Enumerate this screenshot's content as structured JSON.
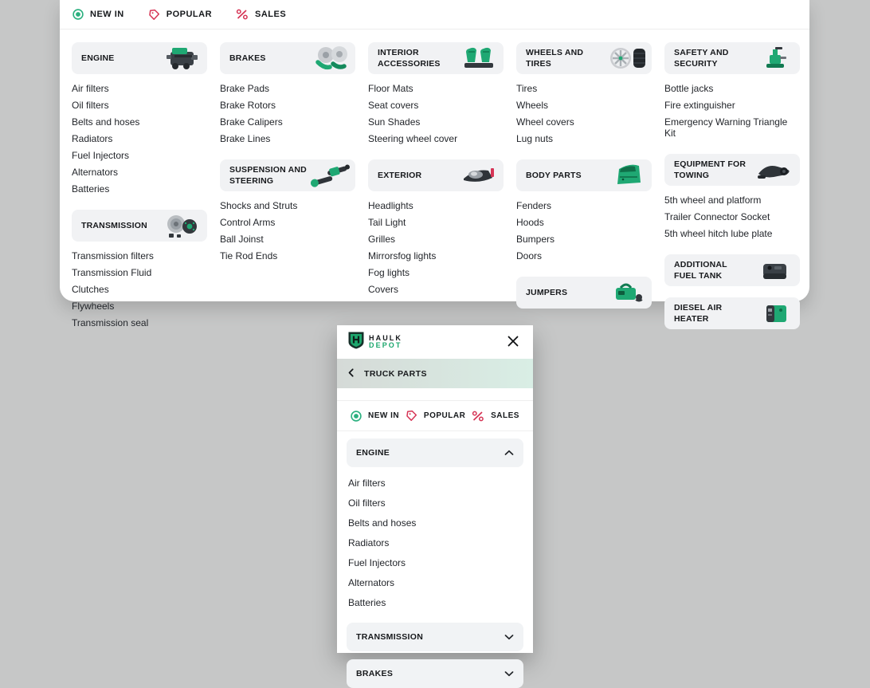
{
  "colors": {
    "accent_green": "#1FA873",
    "logo_green": "#1CA76D",
    "accent_red": "#D63455",
    "tile_gray": "#f1f2f4",
    "page_background": "#c6c7c7",
    "back_bar_gradient": [
      "#d5dad7",
      "#d9eee5"
    ]
  },
  "tabs": [
    {
      "label": "NEW IN",
      "icon": "radio",
      "color": "#2BB07F"
    },
    {
      "label": "POPULAR",
      "icon": "tag",
      "color": "#D63455"
    },
    {
      "label": "SALES",
      "icon": "percent",
      "color": "#D63455"
    }
  ],
  "mega_menu": {
    "columns": [
      [
        {
          "title": "ENGINE",
          "icon": "engine",
          "items": [
            "Air filters",
            "Oil filters",
            "Belts and hoses",
            "Radiators",
            "Fuel Injectors",
            "Alternators",
            "Batteries"
          ]
        },
        {
          "title": "TRANSMISSION",
          "icon": "transmission",
          "items": [
            "Transmission filters",
            "Transmission Fluid",
            "Clutches",
            "Flywheels",
            "Transmission seal"
          ]
        }
      ],
      [
        {
          "title": "BRAKES",
          "icon": "brakes",
          "items": [
            "Brake Pads",
            "Brake Rotors",
            "Brake Calipers",
            "Brake Lines"
          ]
        },
        {
          "title": "SUSPENSION AND STEERING",
          "icon": "suspension",
          "items": [
            "Shocks and Struts",
            "Control Arms",
            "Ball Joinst",
            "Tie Rod Ends"
          ]
        }
      ],
      [
        {
          "title": "INTERIOR ACCESSORIES",
          "icon": "interior",
          "items": [
            "Floor Mats",
            "Seat covers",
            "Sun Shades",
            "Steering wheel cover"
          ]
        },
        {
          "title": "EXTERIOR",
          "icon": "exterior",
          "items": [
            "Headlights",
            "Tail Light",
            "Grilles",
            "Mirrorsfog lights",
            "Fog lights",
            "Covers"
          ]
        }
      ],
      [
        {
          "title": "WHEELS AND TIRES",
          "icon": "wheels",
          "items": [
            "Tires",
            "Wheels",
            "Wheel covers",
            "Lug nuts"
          ]
        },
        {
          "title": "BODY PARTS",
          "icon": "body",
          "items": [
            "Fenders",
            "Hoods",
            "Bumpers",
            "Doors"
          ]
        },
        {
          "title": "JUMPERS",
          "icon": "jumpers",
          "items": []
        }
      ],
      [
        {
          "title": "SAFETY AND SECURITY",
          "icon": "safety",
          "items": [
            "Bottle jacks",
            "Fire extinguisher",
            "Emergency Warning Triangle Kit"
          ]
        },
        {
          "title": "EQUIPMENT FOR TOWING",
          "icon": "towing",
          "items": [
            "5th wheel and platform",
            "Trailer Connector Socket",
            "5th wheel hitch lube plate"
          ]
        },
        {
          "title": "ADDITIONAL FUEL TANK",
          "icon": "fueltank",
          "items": []
        },
        {
          "title": "DIESEL AIR HEATER",
          "icon": "heater",
          "items": []
        }
      ]
    ]
  },
  "mobile_menu": {
    "logo_line1": "HAULK",
    "logo_line2": "DEPOT",
    "logo_icon": "shield",
    "close_icon": "close",
    "back_label": "TRUCK PARTS",
    "back_icon": "chevron-left",
    "accordions": [
      {
        "title": "ENGINE",
        "expanded": true,
        "items": [
          "Air filters",
          "Oil filters",
          "Belts and hoses",
          "Radiators",
          "Fuel Injectors",
          "Alternators",
          "Batteries"
        ]
      },
      {
        "title": "TRANSMISSION",
        "expanded": false,
        "items": []
      },
      {
        "title": "BRAKES",
        "expanded": false,
        "items": []
      }
    ]
  }
}
